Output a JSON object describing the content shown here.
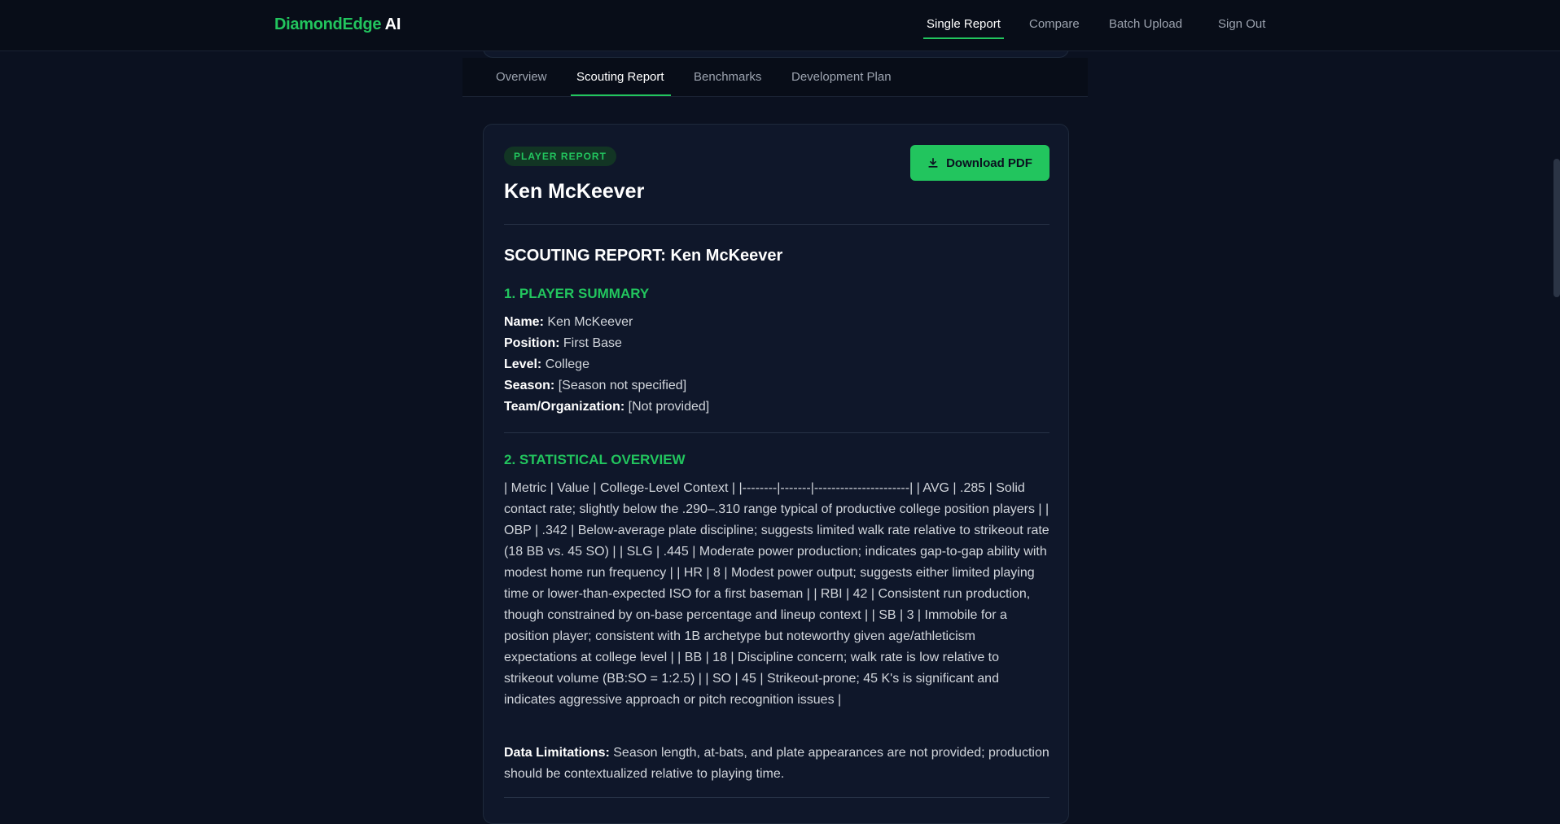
{
  "brand": {
    "name_green": "DiamondEdge",
    "name_white": "AI"
  },
  "nav": {
    "single_report": "Single Report",
    "compare": "Compare",
    "batch_upload": "Batch Upload",
    "sign_out": "Sign Out"
  },
  "tabs": {
    "overview": "Overview",
    "scouting_report": "Scouting Report",
    "benchmarks": "Benchmarks",
    "development_plan": "Development Plan"
  },
  "card": {
    "badge": "PLAYER REPORT",
    "player_name": "Ken McKeever",
    "download_label": "Download PDF",
    "report_title": "SCOUTING REPORT: Ken McKeever",
    "summary_heading": "1. PLAYER SUMMARY",
    "fields": {
      "name_label": "Name:",
      "name_value": "Ken McKeever",
      "position_label": "Position:",
      "position_value": "First Base",
      "level_label": "Level:",
      "level_value": "College",
      "season_label": "Season:",
      "season_value": "[Season not specified]",
      "team_label": "Team/Organization:",
      "team_value": "[Not provided]"
    },
    "stats_heading": "2. STATISTICAL OVERVIEW",
    "stats_text": "| Metric | Value | College-Level Context | |--------|-------|----------------------| | AVG | .285 | Solid contact rate; slightly below the .290–.310 range typical of productive college position players | | OBP | .342 | Below-average plate discipline; suggests limited walk rate relative to strikeout rate (18 BB vs. 45 SO) | | SLG | .445 | Moderate power production; indicates gap-to-gap ability with modest home run frequency | | HR | 8 | Modest power output; suggests either limited playing time or lower-than-expected ISO for a first baseman | | RBI | 42 | Consistent run production, though constrained by on-base percentage and lineup context | | SB | 3 | Immobile for a position player; consistent with 1B archetype but noteworthy given age/athleticism expectations at college level | | BB | 18 | Discipline concern; walk rate is low relative to strikeout volume (BB:SO = 1:2.5) | | SO | 45 | Strikeout-prone; 45 K's is significant and indicates aggressive approach or pitch recognition issues |",
    "limitations_label": "Data Limitations:",
    "limitations_text": "Season length, at-bats, and plate appearances are not provided; production should be contextualized relative to playing time."
  }
}
